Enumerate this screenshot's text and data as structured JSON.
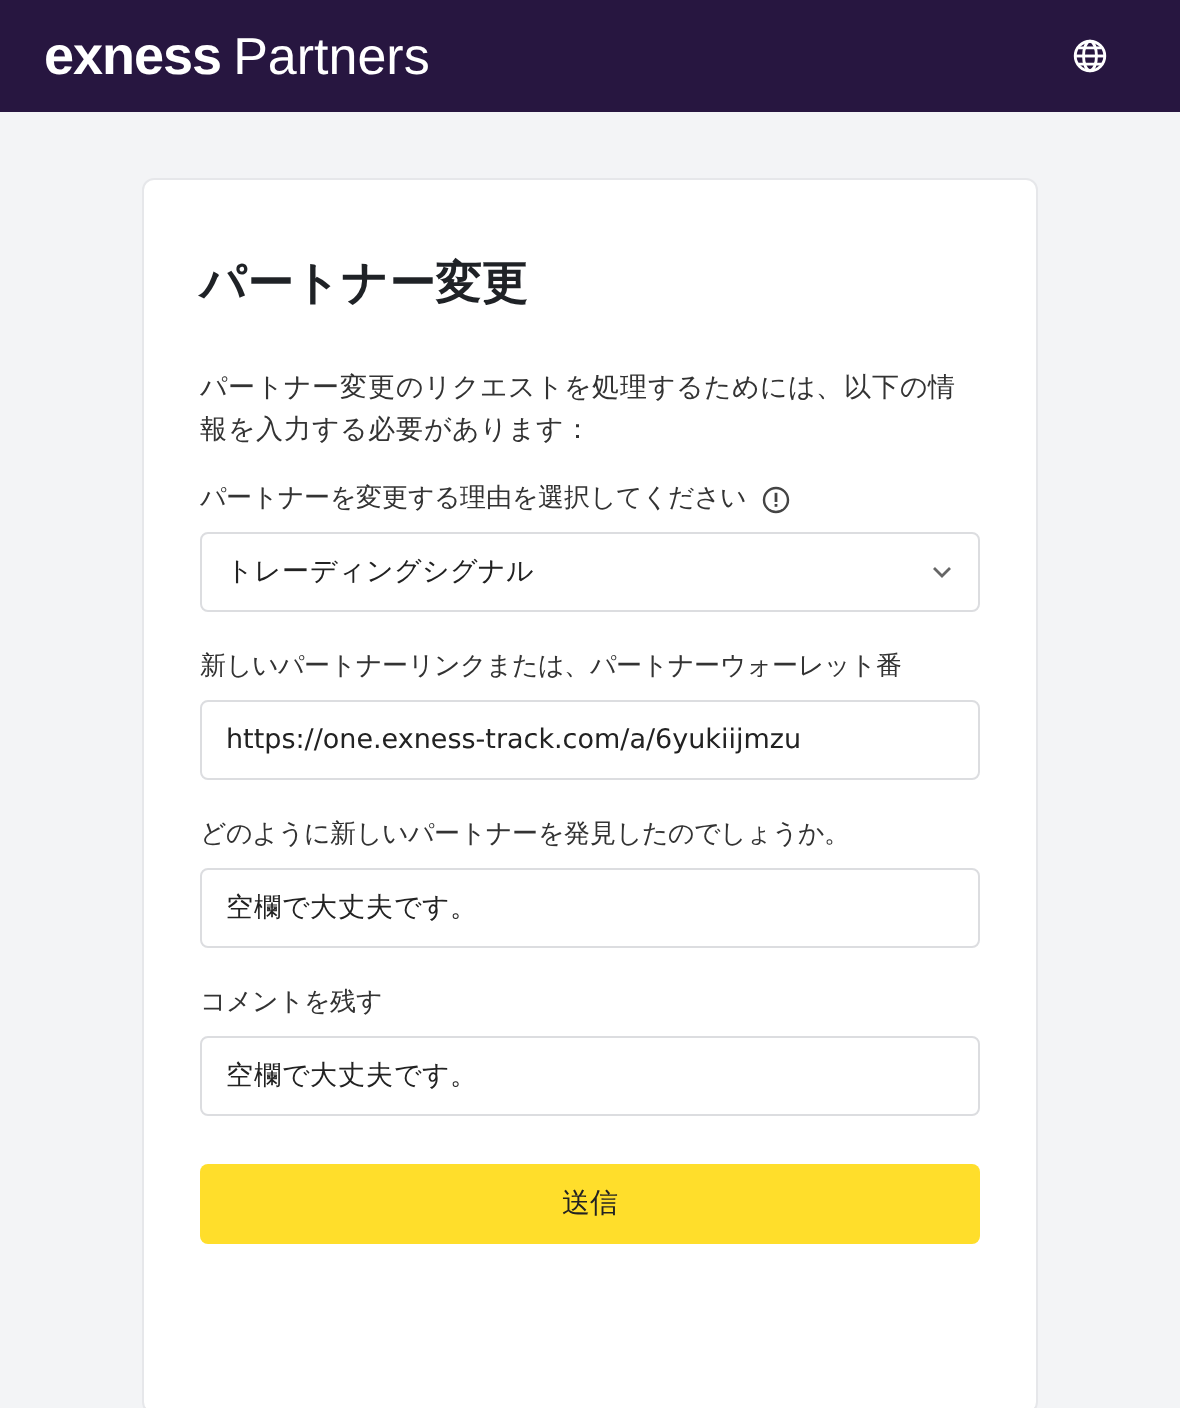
{
  "header": {
    "logo": "exness",
    "logo_suffix": "Partners"
  },
  "form": {
    "title": "パートナー変更",
    "intro": "パートナー変更のリクエストを処理するためには、以下の情報を入力する必要があります：",
    "fields": [
      {
        "kind": "select",
        "label": "パートナーを変更する理由を選択してください",
        "info": true,
        "value": "トレーディングシグナル"
      },
      {
        "kind": "text",
        "label": "新しいパートナーリンクまたは、パートナーウォーレット番",
        "info": false,
        "value": "https://one.exness-track.com/a/6yukiijmzu"
      },
      {
        "kind": "text",
        "label": "どのように新しいパートナーを発見したのでしょうか。",
        "info": false,
        "placeholder": "空欄で大丈夫です。"
      },
      {
        "kind": "text",
        "label": "コメントを残す",
        "info": false,
        "placeholder": "空欄で大丈夫です。"
      }
    ],
    "submit": "送信"
  }
}
